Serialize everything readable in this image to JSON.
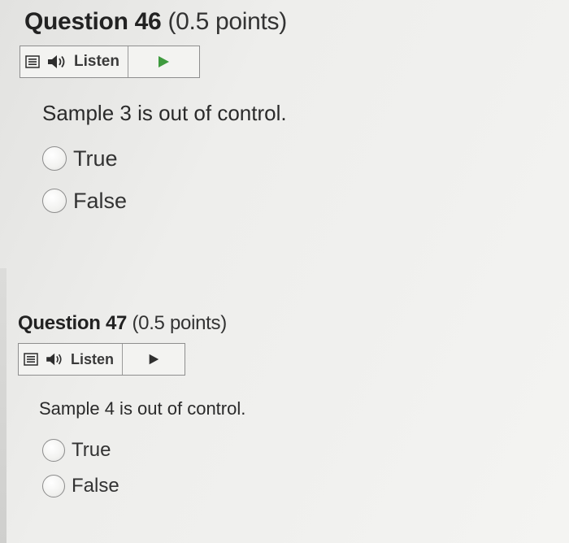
{
  "questions": [
    {
      "title": "Question 46",
      "points": "(0.5 points)",
      "listen_label": "Listen",
      "text": "Sample 3 is out of control.",
      "options": [
        "True",
        "False"
      ]
    },
    {
      "title": "Question 47",
      "points": "(0.5 points)",
      "listen_label": "Listen",
      "text": "Sample 4 is out of control.",
      "options": [
        "True",
        "False"
      ]
    }
  ],
  "colors": {
    "play_q46": "#3e9a3e",
    "play_q47": "#2f2f2f",
    "icons": "#2e2e2e"
  },
  "icons": {
    "menu": "menu-icon",
    "speaker": "speaker-icon",
    "play": "play-icon"
  }
}
